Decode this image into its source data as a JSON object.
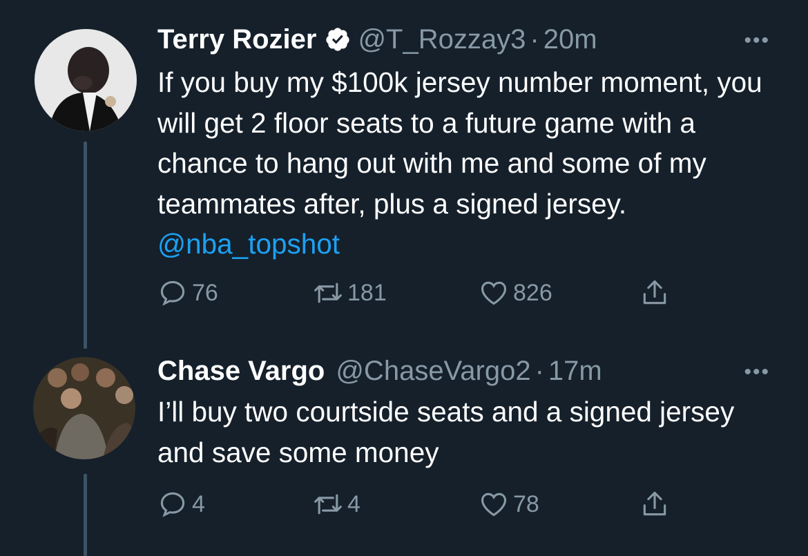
{
  "tweets": [
    {
      "name": "Terry Rozier",
      "verified": true,
      "handle": "@T_Rozzay3",
      "time": "20m",
      "text_plain": "If you buy my $100k jersey number moment, you will get 2 floor seats to a future game with a chance to hang out with me and some of my teammates after, plus a signed jersey.",
      "mention": "@nba_topshot",
      "replies": "76",
      "retweets": "181",
      "likes": "826"
    },
    {
      "name": "Chase Vargo",
      "verified": false,
      "handle": "@ChaseVargo2",
      "time": "17m",
      "text_plain": "I’ll buy two courtside seats and a signed jersey and save some money",
      "replies": "4",
      "retweets": "4",
      "likes": "78"
    }
  ],
  "colors": {
    "background": "#15202b",
    "secondary_text": "#8899a6",
    "link": "#1da1f2",
    "verified_badge": "#ffffff"
  },
  "icons": [
    "verified-badge-icon",
    "more-icon",
    "reply-icon",
    "retweet-icon",
    "like-icon",
    "share-icon"
  ]
}
